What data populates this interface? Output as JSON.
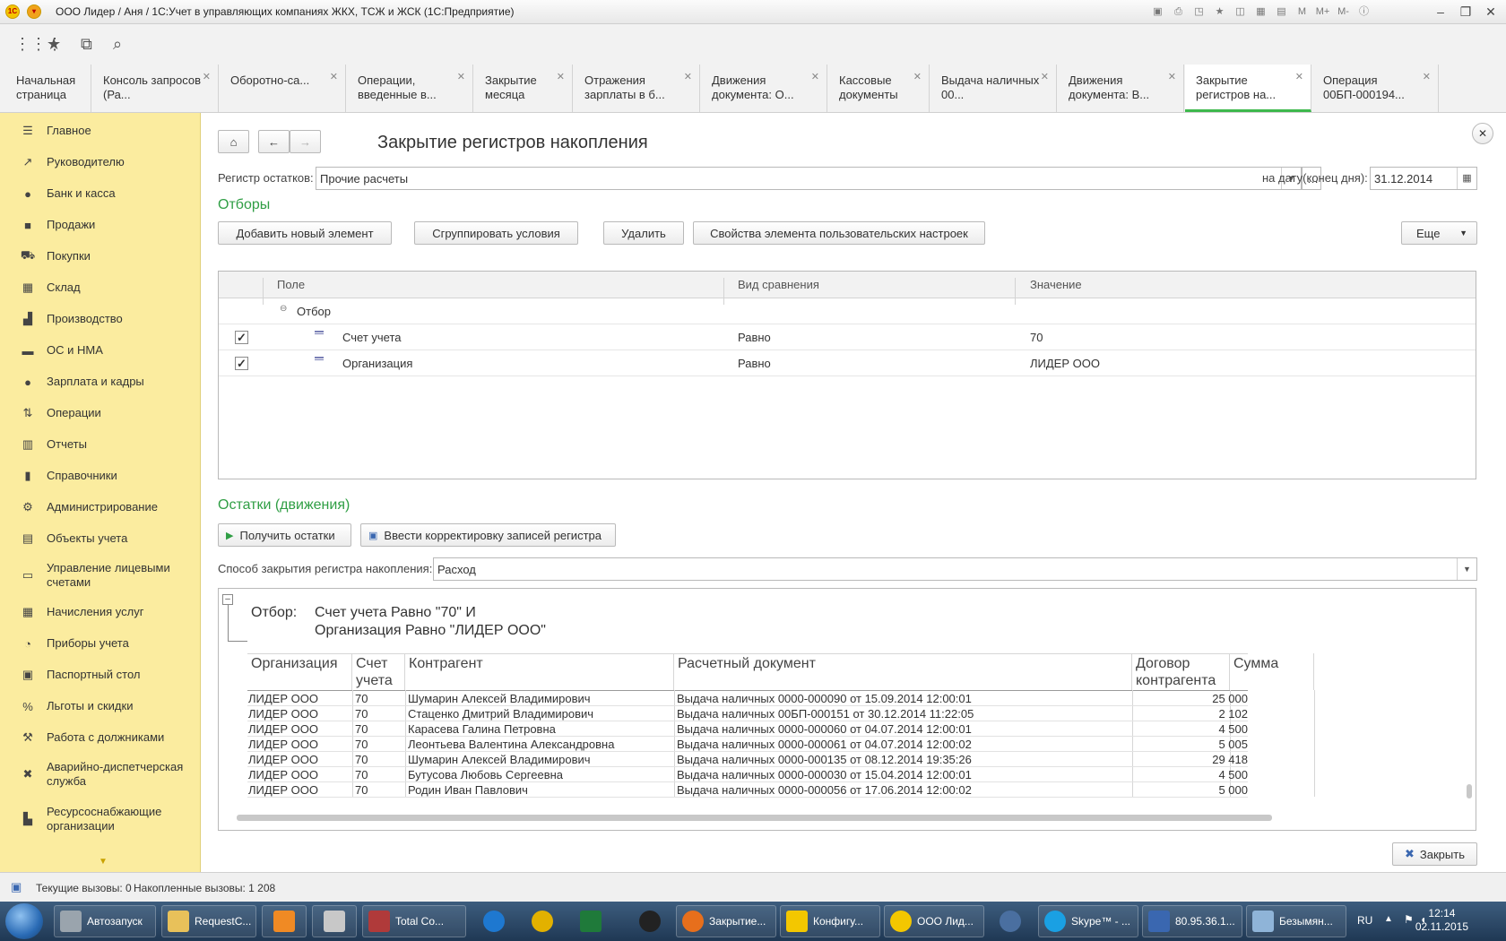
{
  "window": {
    "title": "ООО Лидер / Аня / 1С:Учет в управляющих компаниях ЖКХ, ТСЖ и ЖСК (1С:Предприятие)"
  },
  "tabs": [
    {
      "label": "Начальная страница"
    },
    {
      "label": "Консоль запросов (Ра..."
    },
    {
      "label": "Оборотно-са..."
    },
    {
      "label": "Операции, введенные в..."
    },
    {
      "label": "Закрытие месяца"
    },
    {
      "label": "Отражения зарплаты в б..."
    },
    {
      "label": "Движения документа: О..."
    },
    {
      "label": "Кассовые документы"
    },
    {
      "label": "Выдача наличных 00..."
    },
    {
      "label": "Движения документа: В..."
    },
    {
      "label": "Закрытие регистров на..."
    },
    {
      "label": "Операция 00БП-000194..."
    }
  ],
  "sidebar": {
    "items": [
      {
        "label": "Главное",
        "icon": "menu-icon"
      },
      {
        "label": "Руководителю",
        "icon": "chart-line-icon"
      },
      {
        "label": "Банк и касса",
        "icon": "ruble-icon"
      },
      {
        "label": "Продажи",
        "icon": "bag-icon"
      },
      {
        "label": "Покупки",
        "icon": "cart-icon"
      },
      {
        "label": "Склад",
        "icon": "warehouse-icon"
      },
      {
        "label": "Производство",
        "icon": "factory-icon"
      },
      {
        "label": "ОС и НМА",
        "icon": "truck-icon"
      },
      {
        "label": "Зарплата и кадры",
        "icon": "person-icon"
      },
      {
        "label": "Операции",
        "icon": "operations-icon"
      },
      {
        "label": "Отчеты",
        "icon": "bar-chart-icon"
      },
      {
        "label": "Справочники",
        "icon": "book-icon"
      },
      {
        "label": "Администрирование",
        "icon": "gear-icon"
      },
      {
        "label": "Объекты учета",
        "icon": "table-icon"
      },
      {
        "label": "Управление лицевыми счетами",
        "icon": "card-icon"
      },
      {
        "label": "Начисления услуг",
        "icon": "calculator-icon"
      },
      {
        "label": "Приборы учета",
        "icon": "gauge-icon"
      },
      {
        "label": "Паспортный стол",
        "icon": "passport-icon"
      },
      {
        "label": "Льготы и скидки",
        "icon": "percent-icon"
      },
      {
        "label": "Работа с должниками",
        "icon": "hammer-icon"
      },
      {
        "label": "Аварийно-диспетчерская служба",
        "icon": "tools-icon"
      },
      {
        "label": "Ресурсоснабжающие организации",
        "icon": "building-icon"
      }
    ]
  },
  "form": {
    "title": "Закрытие регистров накопления",
    "register_label": "Регистр остатков:",
    "register_value": "Прочие расчеты",
    "date_label": "на дату(конец дня):",
    "date_value": "31.12.2014",
    "filters_heading": "Отборы",
    "buttons": {
      "add": "Добавить новый элемент",
      "group": "Сгруппировать условия",
      "delete": "Удалить",
      "properties": "Свойства элемента пользовательских настроек",
      "more": "Еще"
    },
    "filter_grid": {
      "columns": [
        "Поле",
        "Вид сравнения",
        "Значение"
      ],
      "group_label": "Отбор",
      "rows": [
        {
          "checked": true,
          "field": "Счет учета",
          "comparison": "Равно",
          "value": "70"
        },
        {
          "checked": true,
          "field": "Организация",
          "comparison": "Равно",
          "value": "ЛИДЕР ООО"
        }
      ]
    },
    "balances_heading": "Остатки (движения)",
    "get_balances": "Получить остатки",
    "enter_correction": "Ввести корректировку записей регистра",
    "method_label": "Способ закрытия регистра накопления:",
    "method_value": "Расход",
    "close_button": "Закрыть"
  },
  "report": {
    "filter_prefix": "Отбор:",
    "filter_line1": "Счет учета Равно \"70\" И",
    "filter_line2": "Организация Равно \"ЛИДЕР ООО\"",
    "columns": [
      "Организация",
      "Счет учета",
      "Контрагент",
      "Расчетный документ",
      "Договор контрагента",
      "Сумма"
    ],
    "rows": [
      {
        "org": "ЛИДЕР ООО",
        "account": "70",
        "counterparty": "Шумарин Алексей Владимирович",
        "document": "Выдача наличных 0000-000090 от 15.09.2014 12:00:01",
        "contract": "",
        "sum": "25 000"
      },
      {
        "org": "ЛИДЕР ООО",
        "account": "70",
        "counterparty": "Стаценко Дмитрий Владимирович",
        "document": "Выдача наличных 00БП-000151 от 30.12.2014 11:22:05",
        "contract": "",
        "sum": "2 102"
      },
      {
        "org": "ЛИДЕР ООО",
        "account": "70",
        "counterparty": "Карасева Галина Петровна",
        "document": "Выдача наличных 0000-000060 от 04.07.2014 12:00:01",
        "contract": "",
        "sum": "4 500"
      },
      {
        "org": "ЛИДЕР ООО",
        "account": "70",
        "counterparty": "Леонтьева Валентина Александровна",
        "document": "Выдача наличных 0000-000061 от 04.07.2014 12:00:02",
        "contract": "",
        "sum": "5 005"
      },
      {
        "org": "ЛИДЕР ООО",
        "account": "70",
        "counterparty": "Шумарин Алексей Владимирович",
        "document": "Выдача наличных 0000-000135 от 08.12.2014 19:35:26",
        "contract": "",
        "sum": "29 418"
      },
      {
        "org": "ЛИДЕР ООО",
        "account": "70",
        "counterparty": "Бутусова Любовь Сергеевна",
        "document": "Выдача наличных 0000-000030 от 15.04.2014 12:00:01",
        "contract": "",
        "sum": "4 500"
      },
      {
        "org": "ЛИДЕР ООО",
        "account": "70",
        "counterparty": "Родин Иван Павлович",
        "document": "Выдача наличных 0000-000056 от 17.06.2014 12:00:02",
        "contract": "",
        "sum": "5 000"
      }
    ]
  },
  "status": {
    "current_calls": "Текущие вызовы: 0",
    "accumulated_calls": "Накопленные вызовы: 1 208"
  },
  "taskbar": {
    "items": [
      {
        "label": "Автозапуск",
        "color": "#9aa4ad"
      },
      {
        "label": "RequestC...",
        "color": "#e8c15a"
      },
      {
        "label": "",
        "color": "#f08a24"
      },
      {
        "label": "",
        "color": "#c8c8c8"
      },
      {
        "label": "Total Co...",
        "color": "#b03a3a"
      },
      {
        "label": "",
        "color": "#1e78d0"
      },
      {
        "label": "",
        "color": "#e2b100"
      },
      {
        "label": "",
        "color": "#1f7a3a"
      },
      {
        "label": "",
        "color": "#222222"
      },
      {
        "label": "Закрытие...",
        "color": "#e76f1c"
      },
      {
        "label": "Конфигу...",
        "color": "#f3c700"
      },
      {
        "label": "ООО Лид...",
        "color": "#f3c700"
      },
      {
        "label": "",
        "color": "#4a6fa0"
      },
      {
        "label": "Skype™ - ...",
        "color": "#1aa0e3"
      },
      {
        "label": "80.95.36.1...",
        "color": "#3a67b0"
      },
      {
        "label": "Безымян...",
        "color": "#8fb4d8"
      }
    ],
    "lang": "RU",
    "time": "12:14",
    "date": "02.11.2015"
  },
  "colors": {
    "accent_green": "#2f9e44",
    "sidebar_bg": "#fbec9f",
    "active_tab_underline": "#3db84c"
  }
}
